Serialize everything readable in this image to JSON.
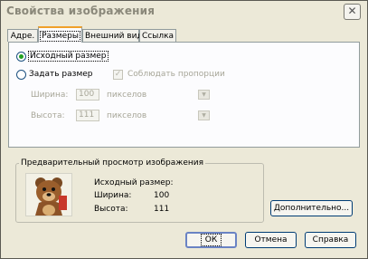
{
  "window": {
    "title": "Свойства изображения",
    "close_glyph": "✕"
  },
  "tabs": [
    {
      "label": "Адре."
    },
    {
      "label": "Размеры"
    },
    {
      "label": "Внешний вид"
    },
    {
      "label": "Ссылка"
    }
  ],
  "size_panel": {
    "original_size_label": "Исходный размер",
    "custom_size_label": "Задать размер",
    "keep_proportions_label": "Соблюдать пропорции",
    "width_label": "Ширина:",
    "width_value": "100",
    "height_label": "Высота:",
    "height_value": "111",
    "unit_label": "пикселов",
    "selected_option": "original"
  },
  "preview": {
    "group_label": "Предварительный просмотр изображения",
    "original_size_label": "Исходный размер:",
    "width_label": "Ширина:",
    "width_value": "100",
    "height_label": "Высота:",
    "height_value": "111"
  },
  "buttons": {
    "advanced": "Дополнительно...",
    "ok": "ОК",
    "cancel": "Отмена",
    "help": "Справка"
  },
  "colors": {
    "window_bg": "#ece9d8",
    "active_tab_accent": "#f0a02a",
    "radio_dot": "#21a121",
    "button_border": "#003c74"
  }
}
